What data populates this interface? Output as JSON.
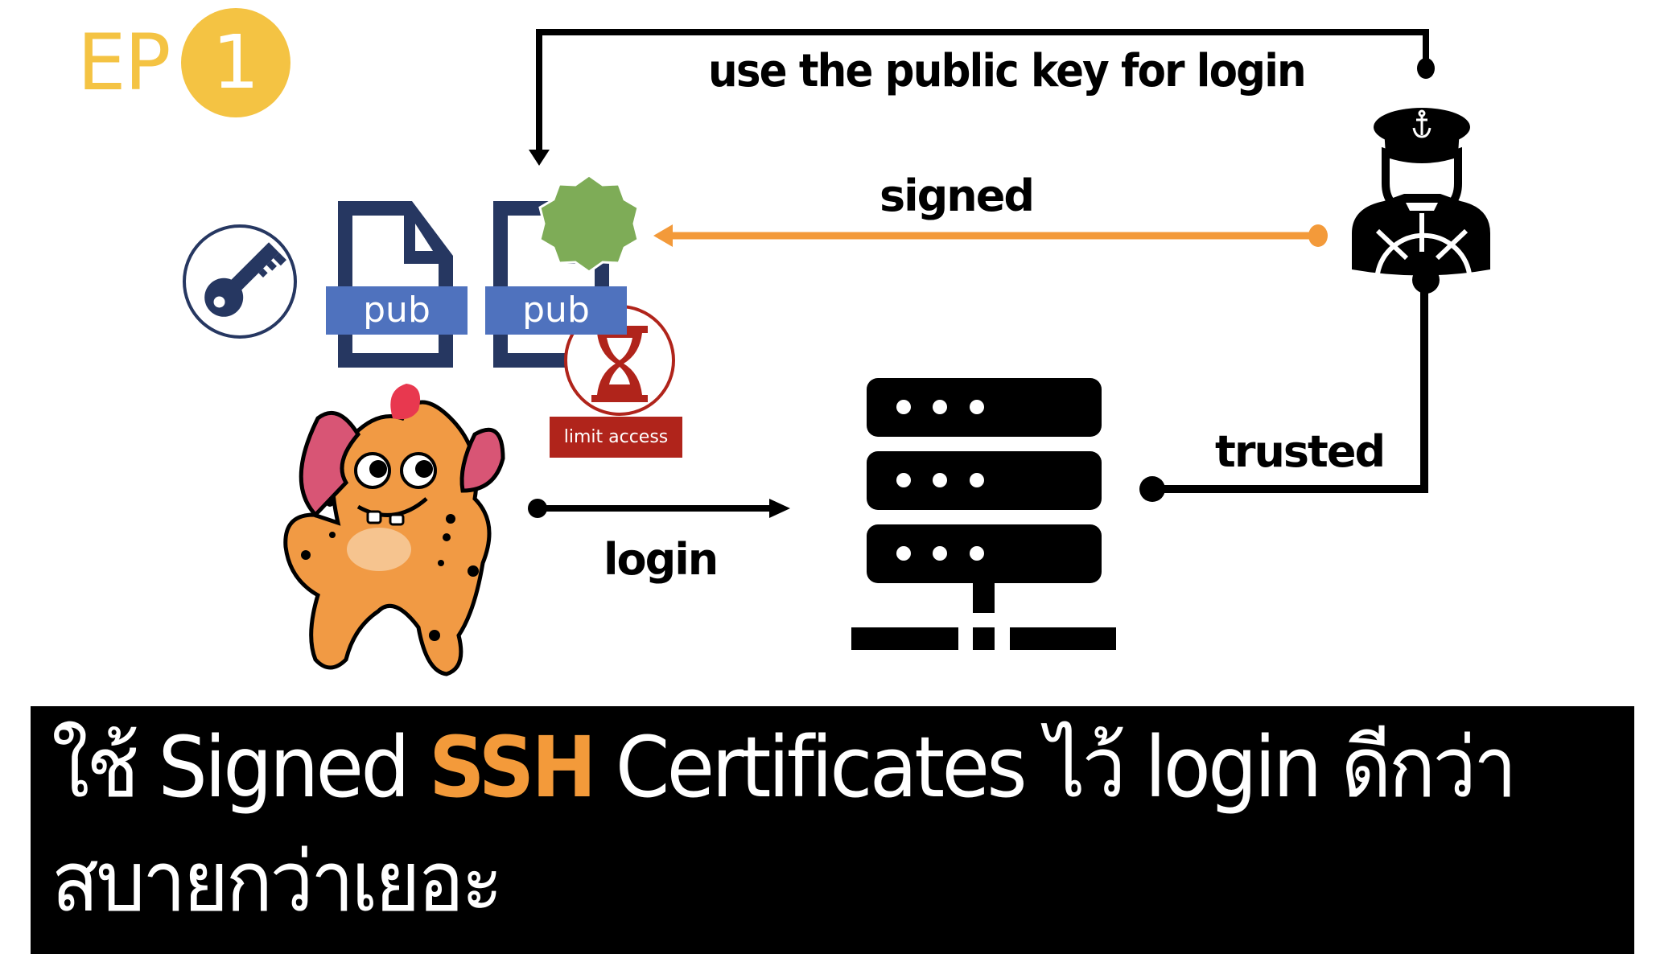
{
  "badge": {
    "prefix": "EP",
    "number": "1",
    "color": "#F4C343"
  },
  "diagram": {
    "labels": {
      "use_public_key": "use the public key for login",
      "signed": "signed",
      "login": "login",
      "trusted": "trusted"
    },
    "files": [
      {
        "name": "public-key-file",
        "tag": "pub"
      },
      {
        "name": "signed-certificate-file",
        "tag": "pub"
      }
    ],
    "limit_access_label": "limit access",
    "icons": [
      "key-icon",
      "document-icon",
      "certificate-seal-icon",
      "hourglass-icon",
      "monster-user-icon",
      "server-icon",
      "ship-captain-icon"
    ],
    "colors": {
      "file_dark": "#263761",
      "pub_tag": "#4F72BE",
      "seal": "#7EAC57",
      "limit": "#B0241B",
      "signed_arrow": "#F39A3A"
    }
  },
  "banner": {
    "line1_pre": "ใช้ Signed ",
    "line1_highlight": "SSH",
    "line1_post": " Certificates ไว้ login ดีกว่า",
    "line2": "สบายกว่าเยอะ",
    "highlight_color": "#F39A3A"
  }
}
